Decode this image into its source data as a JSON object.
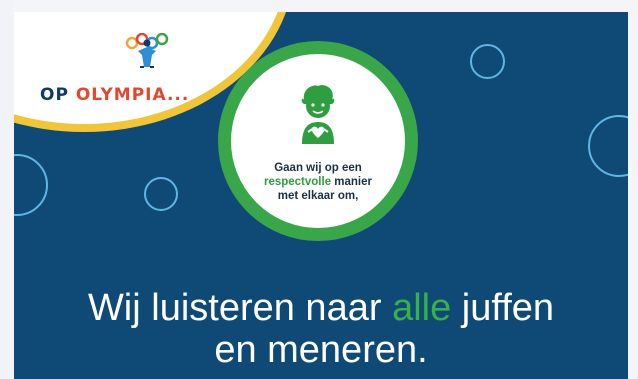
{
  "logo": {
    "word_op": "OP",
    "word_olympia": "OLYMPIA...",
    "icon": "kids-holding-hands-icon"
  },
  "badge": {
    "figure_icon": "child-heart-hands-icon",
    "line1": "Gaan wij op een",
    "line2_highlight": "respectvolle",
    "line2_rest": " manier",
    "line3": "met elkaar om,"
  },
  "headline": {
    "part1": "Wij luisteren naar ",
    "highlight": "alle",
    "part2": " juffen",
    "line2": "en meneren."
  },
  "colors": {
    "background": "#0f4a77",
    "accent_green": "#38b04a",
    "bubble_blue": "#5fb6e4",
    "arc_yellow": "#f0c53a",
    "logo_red": "#e4472f"
  }
}
